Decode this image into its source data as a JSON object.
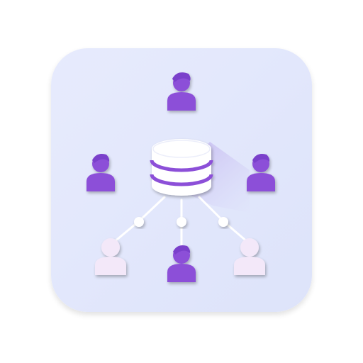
{
  "colors": {
    "background": "#ffffff",
    "tile": "#e1e6fb",
    "tile_edge": "#d3d9f6",
    "tile_shadow": "#c5cdef",
    "accent": "#8c4fd8",
    "accent_dark": "#7a3fcb",
    "accent_light": "#f2e6f8",
    "accent_light_shadow": "#dcc7ee",
    "database_body": "#ffffff",
    "database_shadow": "#b7a6ea",
    "connector": "#ffffff"
  },
  "icons": {
    "tile": "rounded-square-icon",
    "database": "database-icon",
    "user": "user-icon"
  }
}
